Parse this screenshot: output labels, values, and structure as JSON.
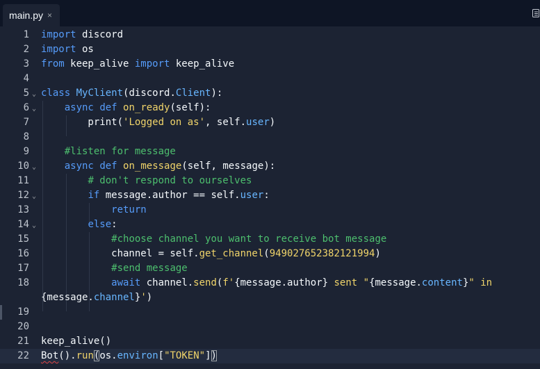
{
  "tab": {
    "label": "main.py",
    "close": "×"
  },
  "lines": [
    {
      "no": "1",
      "fold": "",
      "tokens": [
        [
          "k",
          "import"
        ],
        [
          "t",
          " discord"
        ]
      ]
    },
    {
      "no": "2",
      "fold": "",
      "tokens": [
        [
          "k",
          "import"
        ],
        [
          "t",
          " os"
        ]
      ]
    },
    {
      "no": "3",
      "fold": "",
      "tokens": [
        [
          "k",
          "from"
        ],
        [
          "t",
          " keep_alive "
        ],
        [
          "k",
          "import"
        ],
        [
          "t",
          " keep_alive"
        ]
      ]
    },
    {
      "no": "4",
      "fold": "",
      "tokens": []
    },
    {
      "no": "5",
      "fold": "⌄",
      "tokens": [
        [
          "k",
          "class"
        ],
        [
          "t",
          " "
        ],
        [
          "p",
          "MyClient"
        ],
        [
          "t",
          "(discord."
        ],
        [
          "p",
          "Client"
        ],
        [
          "t",
          "):"
        ]
      ]
    },
    {
      "no": "6",
      "fold": "⌄",
      "tokens": [
        [
          "t",
          "    "
        ],
        [
          "k",
          "async"
        ],
        [
          "t",
          " "
        ],
        [
          "k",
          "def"
        ],
        [
          "t",
          " "
        ],
        [
          "f",
          "on_ready"
        ],
        [
          "t",
          "(self):"
        ]
      ]
    },
    {
      "no": "7",
      "fold": "",
      "tokens": [
        [
          "t",
          "        print("
        ],
        [
          "s",
          "'Logged on as'"
        ],
        [
          "t",
          ", self."
        ],
        [
          "p",
          "user"
        ],
        [
          "t",
          ")"
        ]
      ]
    },
    {
      "no": "8",
      "fold": "",
      "tokens": []
    },
    {
      "no": "9",
      "fold": "",
      "tokens": [
        [
          "t",
          "    "
        ],
        [
          "c",
          "#listen for message"
        ]
      ]
    },
    {
      "no": "10",
      "fold": "⌄",
      "tokens": [
        [
          "t",
          "    "
        ],
        [
          "k",
          "async"
        ],
        [
          "t",
          " "
        ],
        [
          "k",
          "def"
        ],
        [
          "t",
          " "
        ],
        [
          "f",
          "on_message"
        ],
        [
          "t",
          "(self, message):"
        ]
      ]
    },
    {
      "no": "11",
      "fold": "",
      "tokens": [
        [
          "t",
          "        "
        ],
        [
          "c",
          "# don't respond to ourselves"
        ]
      ]
    },
    {
      "no": "12",
      "fold": "⌄",
      "tokens": [
        [
          "t",
          "        "
        ],
        [
          "k",
          "if"
        ],
        [
          "t",
          " message.author == self."
        ],
        [
          "p",
          "user"
        ],
        [
          "t",
          ":"
        ]
      ]
    },
    {
      "no": "13",
      "fold": "",
      "tokens": [
        [
          "t",
          "            "
        ],
        [
          "k",
          "return"
        ]
      ]
    },
    {
      "no": "14",
      "fold": "⌄",
      "tokens": [
        [
          "t",
          "        "
        ],
        [
          "k",
          "else"
        ],
        [
          "t",
          ":"
        ]
      ]
    },
    {
      "no": "15",
      "fold": "",
      "tokens": [
        [
          "t",
          "            "
        ],
        [
          "c",
          "#choose channel you want to receive bot message"
        ]
      ]
    },
    {
      "no": "16",
      "fold": "",
      "tokens": [
        [
          "t",
          "            channel = self."
        ],
        [
          "f",
          "get_channel"
        ],
        [
          "t",
          "("
        ],
        [
          "n",
          "949027652382121994"
        ],
        [
          "t",
          ")"
        ]
      ]
    },
    {
      "no": "17",
      "fold": "",
      "tokens": [
        [
          "t",
          "            "
        ],
        [
          "c",
          "#send message"
        ]
      ]
    },
    {
      "no": "18",
      "fold": "",
      "tokens": [
        [
          "t",
          "            "
        ],
        [
          "k",
          "await"
        ],
        [
          "t",
          " channel."
        ],
        [
          "f",
          "send"
        ],
        [
          "t",
          "("
        ],
        [
          "s",
          "f'"
        ],
        [
          "t",
          "{message.author}"
        ],
        [
          "s",
          " sent \""
        ],
        [
          "t",
          "{message."
        ],
        [
          "p",
          "content"
        ],
        [
          "t",
          "}"
        ],
        [
          "s",
          "\" in"
        ]
      ]
    },
    {
      "no": "",
      "fold": "",
      "tokens": [
        [
          "t",
          "{message."
        ],
        [
          "p",
          "channel"
        ],
        [
          "t",
          "}"
        ],
        [
          "s",
          "'"
        ],
        [
          "t",
          ")"
        ]
      ]
    },
    {
      "no": "19",
      "fold": "",
      "tokens": []
    },
    {
      "no": "20",
      "fold": "",
      "tokens": []
    },
    {
      "no": "21",
      "fold": "",
      "tokens": [
        [
          "t",
          "keep_alive()"
        ]
      ]
    },
    {
      "no": "22",
      "fold": "",
      "tokens": [
        [
          "err",
          "Bot"
        ],
        [
          "t",
          "()."
        ],
        [
          "f",
          "run"
        ],
        [
          "match",
          "("
        ],
        [
          "t",
          "os."
        ],
        [
          "p",
          "environ"
        ],
        [
          "t",
          "["
        ],
        [
          "s",
          "\"TOKEN\""
        ],
        [
          "t",
          "]"
        ],
        [
          "match",
          ")"
        ]
      ]
    }
  ]
}
